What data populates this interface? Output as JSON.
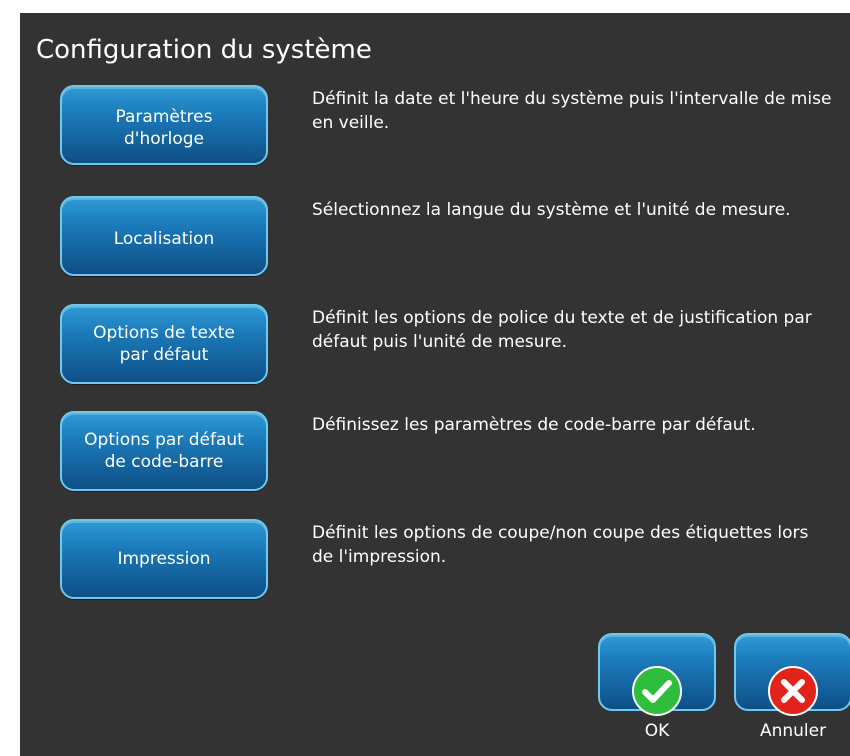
{
  "title": "Configuration du système",
  "options": [
    {
      "label": "Paramètres\nd'horloge",
      "description": "Définit la date et l'heure du système puis l'intervalle de mise en veille."
    },
    {
      "label": "Localisation",
      "description": "Sélectionnez la langue du système et l'unité de mesure."
    },
    {
      "label": "Options de texte\npar défaut",
      "description": "Définit les options de police du texte et de justification par défaut puis l'unité de mesure."
    },
    {
      "label": "Options par défaut\nde code-barre",
      "description": "Définissez les paramètres de code-barre par défaut."
    },
    {
      "label": "Impression",
      "description": "Définit les options de coupe/non coupe des étiquettes lors de l'impression."
    }
  ],
  "footer": {
    "ok_label": "OK",
    "cancel_label": "Annuler",
    "ok_icon": "check-icon",
    "cancel_icon": "close-icon",
    "ok_color": "#2fbd3c",
    "cancel_color": "#e2231a"
  }
}
